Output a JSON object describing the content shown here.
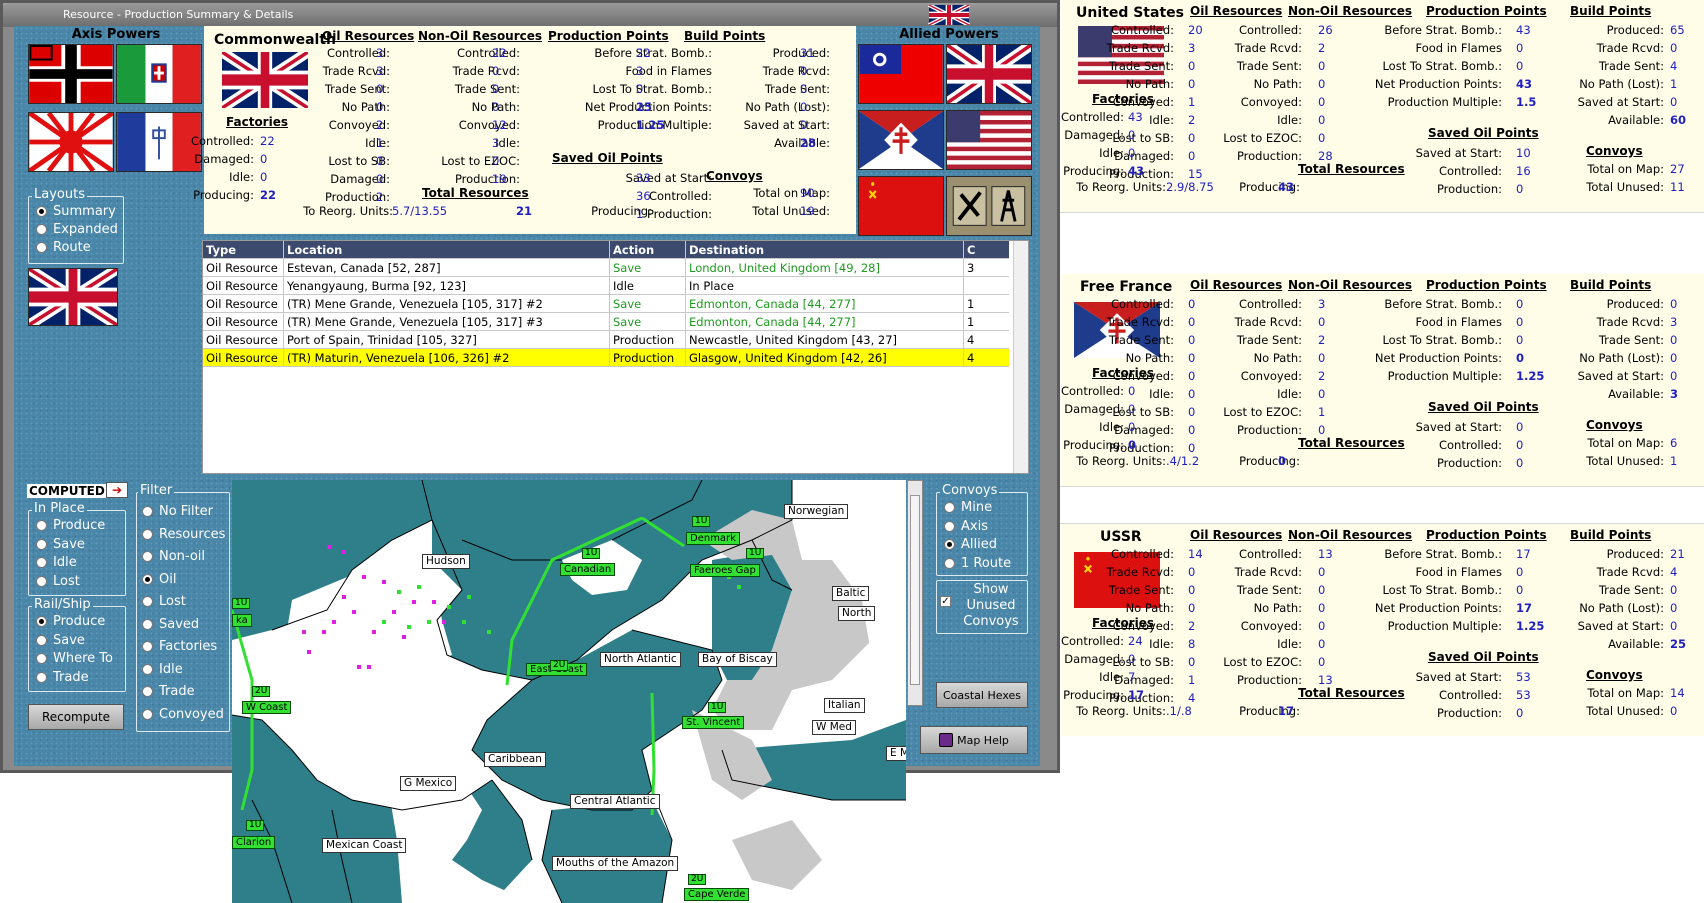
{
  "window": {
    "title": "Resource - Production Summary & Details"
  },
  "axis": {
    "title": "Axis Powers"
  },
  "allied": {
    "title": "Allied Powers"
  },
  "commonwealth": {
    "name": "Commonwealth",
    "oil": {
      "head": "Oil Resources",
      "rows": [
        [
          "Controlled:",
          "3"
        ],
        [
          "Trade Rcvd:",
          "3"
        ],
        [
          "Trade Sent:",
          "0"
        ],
        [
          "No Path:",
          "0"
        ],
        [
          "Convoyed:",
          "2"
        ],
        [
          "Idle:",
          "1"
        ],
        [
          "Lost to SB:",
          "0"
        ],
        [
          "Damaged:",
          "0"
        ],
        [
          "Production:",
          "2"
        ]
      ]
    },
    "nonoil": {
      "head": "Non-Oil Resources",
      "rows": [
        [
          "Controlled:",
          "22"
        ],
        [
          "Trade Rcvd:",
          "0"
        ],
        [
          "Trade Sent:",
          "0"
        ],
        [
          "No Path:",
          "0"
        ],
        [
          "Convoyed:",
          "12"
        ],
        [
          "Idle:",
          "3"
        ],
        [
          "Lost to EZOC:",
          "0"
        ],
        [
          "Production:",
          "19"
        ]
      ]
    },
    "pp": {
      "head": "Production Points",
      "rows": [
        [
          "Before Strat. Bomb.:",
          "22"
        ],
        [
          "Food in Flames",
          "3"
        ],
        [
          "Lost To Strat. Bomb.:",
          "0"
        ],
        [
          "Net Production Points:",
          "25"
        ],
        [
          "Production Multiple:",
          "1.25"
        ]
      ]
    },
    "saved": {
      "head": "Saved Oil Points",
      "rows": [
        [
          "Saved at Start:",
          "33"
        ],
        [
          "Controlled:",
          "36"
        ],
        [
          "Production:",
          "1"
        ]
      ]
    },
    "bp": {
      "head": "Build Points",
      "rows": [
        [
          "Produced:",
          "31"
        ],
        [
          "Trade Rcvd:",
          "0"
        ],
        [
          "Trade Sent:",
          "0"
        ],
        [
          "No Path (Lost):",
          "0"
        ],
        [
          "Saved at Start:",
          "0"
        ],
        [
          "Available:",
          "28"
        ]
      ]
    },
    "convoys": {
      "head": "Convoys",
      "rows": [
        [
          "Total on Map:",
          "90"
        ],
        [
          "Total Unused:",
          "19"
        ]
      ]
    },
    "factories": {
      "head": "Factories",
      "rows": [
        [
          "Controlled:",
          "22"
        ],
        [
          "Damaged:",
          "0"
        ],
        [
          "Idle:",
          "0"
        ],
        [
          "Producing:",
          "22"
        ]
      ]
    },
    "total": {
      "head": "Total Resources",
      "reorg_label": "To Reorg. Units:",
      "reorg": "5.7/13.55",
      "producing_label": "Producing:",
      "producing": "21"
    }
  },
  "layouts": {
    "title": "Layouts",
    "options": [
      "Summary",
      "Expanded",
      "Route"
    ],
    "selected": 0
  },
  "computed": {
    "label": "COMPUTED"
  },
  "inplace": {
    "title": "In Place",
    "options": [
      "Produce",
      "Save",
      "Idle",
      "Lost"
    ]
  },
  "railship": {
    "title": "Rail/Ship",
    "options": [
      "Produce",
      "Save",
      "Where To",
      "Trade"
    ],
    "selected": 0
  },
  "recompute": {
    "label": "Recompute"
  },
  "filter": {
    "title": "Filter",
    "options": [
      "No Filter",
      "Resources",
      "Non-oil",
      "Oil",
      "Lost",
      "Saved",
      "Factories",
      "Idle",
      "Trade",
      "Convoyed"
    ],
    "selected": 3
  },
  "convoys_box": {
    "title": "Convoys",
    "options": [
      "Mine",
      "Axis",
      "Allied",
      "1 Route"
    ],
    "selected": 2,
    "show_unused": "Show Unused Convoys"
  },
  "coastal_btn": {
    "label": "Coastal Hexes"
  },
  "maphelp_btn": {
    "label": "Map Help"
  },
  "table": {
    "headers": [
      "Type",
      "Location",
      "Action",
      "Destination",
      "C"
    ],
    "rows": [
      [
        "Oil Resource",
        "Estevan, Canada [52, 287]",
        "Save",
        "London, United Kingdom [49, 28]",
        "3"
      ],
      [
        "Oil Resource",
        "Yenangyaung, Burma [92, 123]",
        "Idle",
        "In Place",
        ""
      ],
      [
        "Oil Resource",
        "(TR) Mene Grande, Venezuela [105, 317] #2",
        "Save",
        "Edmonton, Canada [44, 277]",
        "1"
      ],
      [
        "Oil Resource",
        "(TR) Mene Grande, Venezuela [105, 317] #3",
        "Save",
        "Edmonton, Canada [44, 277]",
        "1"
      ],
      [
        "Oil Resource",
        "Port of Spain, Trinidad [105, 327]",
        "Production",
        "Newcastle, United Kingdom [43, 27]",
        "4"
      ],
      [
        "Oil Resource",
        "(TR) Maturin, Venezuela [106, 326] #2",
        "Production",
        "Glasgow, United Kingdom [42, 26]",
        "4"
      ]
    ]
  },
  "map": {
    "labels": [
      "Norwegian",
      "Denmark",
      "Faeroes Gap",
      "Canadian",
      "Hudson",
      "Baltic",
      "North",
      "North Atlantic",
      "Bay of Biscay",
      "East Coast",
      "Italian",
      "W Coast",
      "St. Vincent",
      "W Med",
      "Caribbean",
      "G Mexico",
      "E Med",
      "Central Atlantic",
      "Mexican Coast",
      "Mouths of the Amazon",
      "Clarion",
      "Cape Verde",
      "ka"
    ],
    "units": [
      "1U",
      "1U",
      "1U",
      "2U",
      "2U",
      "1U",
      "1U",
      "2U",
      "1U"
    ]
  },
  "us": {
    "name": "United States",
    "oil": {
      "head": "Oil Resources",
      "rows": [
        [
          "Controlled:",
          "20"
        ],
        [
          "Trade Rcvd:",
          "3"
        ],
        [
          "Trade Sent:",
          "0"
        ],
        [
          "No Path:",
          "0"
        ],
        [
          "Convoyed:",
          "1"
        ],
        [
          "Idle:",
          "2"
        ],
        [
          "Lost to SB:",
          "0"
        ],
        [
          "Damaged:",
          "0"
        ],
        [
          "Production:",
          "15"
        ]
      ]
    },
    "nonoil": {
      "head": "Non-Oil Resources",
      "rows": [
        [
          "Controlled:",
          "26"
        ],
        [
          "Trade Rcvd:",
          "2"
        ],
        [
          "Trade Sent:",
          "0"
        ],
        [
          "No Path:",
          "0"
        ],
        [
          "Convoyed:",
          "0"
        ],
        [
          "Idle:",
          "0"
        ],
        [
          "Lost to EZOC:",
          "0"
        ],
        [
          "Production:",
          "28"
        ]
      ]
    },
    "pp": {
      "head": "Production Points",
      "rows": [
        [
          "Before Strat. Bomb.:",
          "43"
        ],
        [
          "Food in Flames",
          "0"
        ],
        [
          "Lost To Strat. Bomb.:",
          "0"
        ],
        [
          "Net Production Points:",
          "43"
        ],
        [
          "Production Multiple:",
          "1.5"
        ]
      ]
    },
    "saved": {
      "head": "Saved Oil Points",
      "rows": [
        [
          "Saved at Start:",
          "10"
        ],
        [
          "Controlled:",
          "16"
        ],
        [
          "Production:",
          "0"
        ]
      ]
    },
    "bp": {
      "head": "Build Points",
      "rows": [
        [
          "Produced:",
          "65"
        ],
        [
          "Trade Rcvd:",
          "0"
        ],
        [
          "Trade Sent:",
          "4"
        ],
        [
          "No Path (Lost):",
          "1"
        ],
        [
          "Saved at Start:",
          "0"
        ],
        [
          "Available:",
          "60"
        ]
      ]
    },
    "convoys": {
      "head": "Convoys",
      "rows": [
        [
          "Total on Map:",
          "27"
        ],
        [
          "Total Unused:",
          "11"
        ]
      ]
    },
    "factories": {
      "head": "Factories",
      "rows": [
        [
          "Controlled:",
          "43"
        ],
        [
          "Damaged:",
          "0"
        ],
        [
          "Idle:",
          "0"
        ],
        [
          "Producing:",
          "43"
        ]
      ]
    },
    "total": {
      "head": "Total Resources",
      "reorg_label": "To Reorg. Units:",
      "reorg": "2.9/8.75",
      "producing_label": "Producing:",
      "producing": "43"
    }
  },
  "ff": {
    "name": "Free France",
    "oil": {
      "head": "Oil Resources",
      "rows": [
        [
          "Controlled:",
          "0"
        ],
        [
          "Trade Rcvd:",
          "0"
        ],
        [
          "Trade Sent:",
          "0"
        ],
        [
          "No Path:",
          "0"
        ],
        [
          "Convoyed:",
          "0"
        ],
        [
          "Idle:",
          "0"
        ],
        [
          "Lost to SB:",
          "0"
        ],
        [
          "Damaged:",
          "0"
        ],
        [
          "Production:",
          "0"
        ]
      ]
    },
    "nonoil": {
      "head": "Non-Oil Resources",
      "rows": [
        [
          "Controlled:",
          "3"
        ],
        [
          "Trade Rcvd:",
          "0"
        ],
        [
          "Trade Sent:",
          "2"
        ],
        [
          "No Path:",
          "0"
        ],
        [
          "Convoyed:",
          "2"
        ],
        [
          "Idle:",
          "0"
        ],
        [
          "Lost to EZOC:",
          "1"
        ],
        [
          "Production:",
          "0"
        ]
      ]
    },
    "pp": {
      "head": "Production Points",
      "rows": [
        [
          "Before Strat. Bomb.:",
          "0"
        ],
        [
          "Food in Flames",
          "0"
        ],
        [
          "Lost To Strat. Bomb.:",
          "0"
        ],
        [
          "Net Production Points:",
          "0"
        ],
        [
          "Production Multiple:",
          "1.25"
        ]
      ]
    },
    "saved": {
      "head": "Saved Oil Points",
      "rows": [
        [
          "Saved at Start:",
          "0"
        ],
        [
          "Controlled:",
          "0"
        ],
        [
          "Production:",
          "0"
        ]
      ]
    },
    "bp": {
      "head": "Build Points",
      "rows": [
        [
          "Produced:",
          "0"
        ],
        [
          "Trade Rcvd:",
          "3"
        ],
        [
          "Trade Sent:",
          "0"
        ],
        [
          "No Path (Lost):",
          "0"
        ],
        [
          "Saved at Start:",
          "0"
        ],
        [
          "Available:",
          "3"
        ]
      ]
    },
    "convoys": {
      "head": "Convoys",
      "rows": [
        [
          "Total on Map:",
          "6"
        ],
        [
          "Total Unused:",
          "1"
        ]
      ]
    },
    "factories": {
      "head": "Factories",
      "rows": [
        [
          "Controlled:",
          "0"
        ],
        [
          "Damaged:",
          "0"
        ],
        [
          "Idle:",
          "0"
        ],
        [
          "Producing:",
          "0"
        ]
      ]
    },
    "total": {
      "head": "Total Resources",
      "reorg_label": "To Reorg. Units:",
      "reorg": ".4/1.2",
      "producing_label": "Producing:",
      "producing": "0"
    }
  },
  "ussr": {
    "name": "USSR",
    "oil": {
      "head": "Oil Resources",
      "rows": [
        [
          "Controlled:",
          "14"
        ],
        [
          "Trade Rcvd:",
          "0"
        ],
        [
          "Trade Sent:",
          "0"
        ],
        [
          "No Path:",
          "0"
        ],
        [
          "Convoyed:",
          "2"
        ],
        [
          "Idle:",
          "8"
        ],
        [
          "Lost to SB:",
          "0"
        ],
        [
          "Damaged:",
          "1"
        ],
        [
          "Production:",
          "4"
        ]
      ]
    },
    "nonoil": {
      "head": "Non-Oil Resources",
      "rows": [
        [
          "Controlled:",
          "13"
        ],
        [
          "Trade Rcvd:",
          "0"
        ],
        [
          "Trade Sent:",
          "0"
        ],
        [
          "No Path:",
          "0"
        ],
        [
          "Convoyed:",
          "0"
        ],
        [
          "Idle:",
          "0"
        ],
        [
          "Lost to EZOC:",
          "0"
        ],
        [
          "Production:",
          "13"
        ]
      ]
    },
    "pp": {
      "head": "Production Points",
      "rows": [
        [
          "Before Strat. Bomb.:",
          "17"
        ],
        [
          "Food in Flames",
          "0"
        ],
        [
          "Lost To Strat. Bomb.:",
          "0"
        ],
        [
          "Net Production Points:",
          "17"
        ],
        [
          "Production Multiple:",
          "1.25"
        ]
      ]
    },
    "saved": {
      "head": "Saved Oil Points",
      "rows": [
        [
          "Saved at Start:",
          "53"
        ],
        [
          "Controlled:",
          "53"
        ],
        [
          "Production:",
          "0"
        ]
      ]
    },
    "bp": {
      "head": "Build Points",
      "rows": [
        [
          "Produced:",
          "21"
        ],
        [
          "Trade Rcvd:",
          "4"
        ],
        [
          "Trade Sent:",
          "0"
        ],
        [
          "No Path (Lost):",
          "0"
        ],
        [
          "Saved at Start:",
          "0"
        ],
        [
          "Available:",
          "25"
        ]
      ]
    },
    "convoys": {
      "head": "Convoys",
      "rows": [
        [
          "Total on Map:",
          "14"
        ],
        [
          "Total Unused:",
          "0"
        ]
      ]
    },
    "factories": {
      "head": "Factories",
      "rows": [
        [
          "Controlled:",
          "24"
        ],
        [
          "Damaged:",
          "0"
        ],
        [
          "Idle:",
          "7"
        ],
        [
          "Producing:",
          "17"
        ]
      ]
    },
    "total": {
      "head": "Total Resources",
      "reorg_label": "To Reorg. Units:",
      "reorg": ".1/.8",
      "producing_label": "Producing:",
      "producing": "17"
    }
  },
  "colors": {
    "panel_blue": "#4a86a8",
    "summary_bg": "#fffde8",
    "value_blue": "#2020c0",
    "save_green": "#1e9a1e",
    "highlight": "#ffff00",
    "map_sea": "#2e7f8a",
    "unit_green": "#32e032"
  }
}
